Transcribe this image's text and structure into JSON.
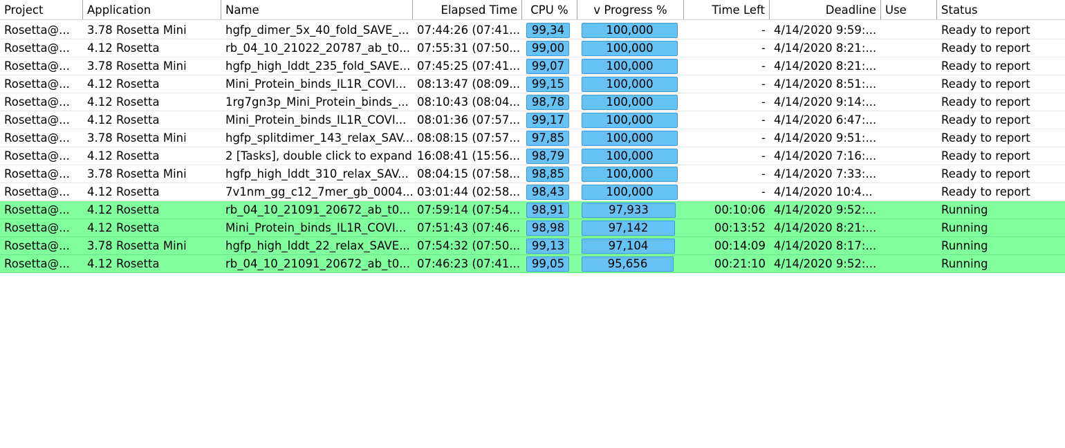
{
  "columns": {
    "project": "Project",
    "application": "Application",
    "name": "Name",
    "elapsed": "Elapsed Time",
    "cpu": "CPU %",
    "progress": "v Progress %",
    "time_left": "Time Left",
    "deadline": "Deadline",
    "use": "Use",
    "status": "Status"
  },
  "colors": {
    "running_row": "#80ff9c",
    "bar_fill": "#66c2f5",
    "bar_border": "#3a9ae0"
  },
  "rows": [
    {
      "project": "Rosetta@...",
      "application": "3.78 Rosetta Mini",
      "name": "hgfp_dimer_5x_40_fold_SAVE_...",
      "elapsed": "07:44:26 (07:41...",
      "cpu": "99,34",
      "cpu_value": 99.34,
      "progress": "100,000",
      "progress_value": 100.0,
      "time_left": "-",
      "deadline": "4/14/2020 9:59:...",
      "use": "",
      "status": "Ready to report",
      "running": false
    },
    {
      "project": "Rosetta@...",
      "application": "4.12 Rosetta",
      "name": "rb_04_10_21022_20787_ab_t0...",
      "elapsed": "07:55:31 (07:50...",
      "cpu": "99,00",
      "cpu_value": 99.0,
      "progress": "100,000",
      "progress_value": 100.0,
      "time_left": "-",
      "deadline": "4/14/2020 8:21:...",
      "use": "",
      "status": "Ready to report",
      "running": false
    },
    {
      "project": "Rosetta@...",
      "application": "3.78 Rosetta Mini",
      "name": "hgfp_high_lddt_235_fold_SAVE...",
      "elapsed": "07:45:25 (07:41...",
      "cpu": "99,07",
      "cpu_value": 99.07,
      "progress": "100,000",
      "progress_value": 100.0,
      "time_left": "-",
      "deadline": "4/14/2020 8:21:...",
      "use": "",
      "status": "Ready to report",
      "running": false
    },
    {
      "project": "Rosetta@...",
      "application": "4.12 Rosetta",
      "name": "Mini_Protein_binds_IL1R_COVI...",
      "elapsed": "08:13:47 (08:09...",
      "cpu": "99,15",
      "cpu_value": 99.15,
      "progress": "100,000",
      "progress_value": 100.0,
      "time_left": "-",
      "deadline": "4/14/2020 8:51:...",
      "use": "",
      "status": "Ready to report",
      "running": false
    },
    {
      "project": "Rosetta@...",
      "application": "4.12 Rosetta",
      "name": "1rg7gn3p_Mini_Protein_binds_...",
      "elapsed": "08:10:43 (08:04...",
      "cpu": "98,78",
      "cpu_value": 98.78,
      "progress": "100,000",
      "progress_value": 100.0,
      "time_left": "-",
      "deadline": "4/14/2020 9:14:...",
      "use": "",
      "status": "Ready to report",
      "running": false
    },
    {
      "project": "Rosetta@...",
      "application": "4.12 Rosetta",
      "name": "Mini_Protein_binds_IL1R_COVI...",
      "elapsed": "08:01:36 (07:57...",
      "cpu": "99,17",
      "cpu_value": 99.17,
      "progress": "100,000",
      "progress_value": 100.0,
      "time_left": "-",
      "deadline": "4/14/2020 6:47:...",
      "use": "",
      "status": "Ready to report",
      "running": false
    },
    {
      "project": "Rosetta@...",
      "application": "3.78 Rosetta Mini",
      "name": "hgfp_splitdimer_143_relax_SAV...",
      "elapsed": "08:08:15 (07:57...",
      "cpu": "97,85",
      "cpu_value": 97.85,
      "progress": "100,000",
      "progress_value": 100.0,
      "time_left": "-",
      "deadline": "4/14/2020 9:51:...",
      "use": "",
      "status": "Ready to report",
      "running": false
    },
    {
      "project": "Rosetta@...",
      "application": "4.12 Rosetta",
      "name": "2 [Tasks], double click to expand",
      "elapsed": "16:08:41 (15:56...",
      "cpu": "98,79",
      "cpu_value": 98.79,
      "progress": "100,000",
      "progress_value": 100.0,
      "time_left": "-",
      "deadline": "4/14/2020 7:16:...",
      "use": "",
      "status": "Ready to report",
      "running": false
    },
    {
      "project": "Rosetta@...",
      "application": "3.78 Rosetta Mini",
      "name": "hgfp_high_lddt_310_relax_SAV...",
      "elapsed": "08:04:15 (07:58...",
      "cpu": "98,85",
      "cpu_value": 98.85,
      "progress": "100,000",
      "progress_value": 100.0,
      "time_left": "-",
      "deadline": "4/14/2020 7:33:...",
      "use": "",
      "status": "Ready to report",
      "running": false
    },
    {
      "project": "Rosetta@...",
      "application": "4.12 Rosetta",
      "name": "7v1nm_gg_c12_7mer_gb_0004...",
      "elapsed": "03:01:44 (02:58...",
      "cpu": "98,43",
      "cpu_value": 98.43,
      "progress": "100,000",
      "progress_value": 100.0,
      "time_left": "-",
      "deadline": "4/14/2020 10:4...",
      "use": "",
      "status": "Ready to report",
      "running": false
    },
    {
      "project": "Rosetta@...",
      "application": "4.12 Rosetta",
      "name": "rb_04_10_21091_20672_ab_t0...",
      "elapsed": "07:59:14 (07:54...",
      "cpu": "98,91",
      "cpu_value": 98.91,
      "progress": "97,933",
      "progress_value": 97.933,
      "time_left": "00:10:06",
      "deadline": "4/14/2020 9:52:...",
      "use": "",
      "status": "Running",
      "running": true
    },
    {
      "project": "Rosetta@...",
      "application": "4.12 Rosetta",
      "name": "Mini_Protein_binds_IL1R_COVI...",
      "elapsed": "07:51:43 (07:46...",
      "cpu": "98,98",
      "cpu_value": 98.98,
      "progress": "97,142",
      "progress_value": 97.142,
      "time_left": "00:13:52",
      "deadline": "4/14/2020 8:21:...",
      "use": "",
      "status": "Running",
      "running": true
    },
    {
      "project": "Rosetta@...",
      "application": "3.78 Rosetta Mini",
      "name": "hgfp_high_lddt_22_relax_SAVE...",
      "elapsed": "07:54:32 (07:50...",
      "cpu": "99,13",
      "cpu_value": 99.13,
      "progress": "97,104",
      "progress_value": 97.104,
      "time_left": "00:14:09",
      "deadline": "4/14/2020 8:17:...",
      "use": "",
      "status": "Running",
      "running": true
    },
    {
      "project": "Rosetta@...",
      "application": "4.12 Rosetta",
      "name": "rb_04_10_21091_20672_ab_t0...",
      "elapsed": "07:46:23 (07:41...",
      "cpu": "99,05",
      "cpu_value": 99.05,
      "progress": "95,656",
      "progress_value": 95.656,
      "time_left": "00:21:10",
      "deadline": "4/14/2020 9:52:...",
      "use": "",
      "status": "Running",
      "running": true
    }
  ]
}
